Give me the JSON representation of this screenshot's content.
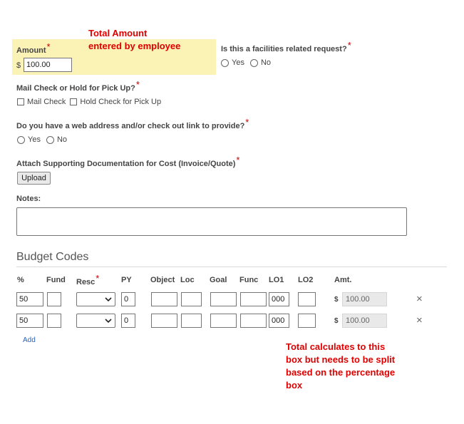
{
  "annotations": {
    "total_amount_line1": "Total Amount",
    "total_amount_line2": "entered by employee",
    "total_calc_line1": "Total calculates to this",
    "total_calc_line2": "box but needs to be split",
    "total_calc_line3": "based on the percentage",
    "total_calc_line4": "box"
  },
  "amount": {
    "label": "Amount",
    "currency": "$",
    "value": "100.00"
  },
  "facilities": {
    "question": "Is this a facilities related request?",
    "yes": "Yes",
    "no": "No"
  },
  "mail_check": {
    "question": "Mail Check or Hold for Pick Up?",
    "option1": "Mail Check",
    "option2": "Hold Check for Pick Up"
  },
  "web_address": {
    "question": "Do you have a web address and/or check out link to provide?",
    "yes": "Yes",
    "no": "No"
  },
  "attach": {
    "question": "Attach Supporting Documentation for Cost (Invoice/Quote)",
    "button": "Upload"
  },
  "notes": {
    "label": "Notes:",
    "value": ""
  },
  "budget": {
    "title": "Budget Codes",
    "headers": {
      "pct": "%",
      "fund": "Fund",
      "resc": "Resc",
      "py": "PY",
      "object": "Object",
      "loc": "Loc",
      "goal": "Goal",
      "func": "Func",
      "lo1": "LO1",
      "lo2": "LO2",
      "amt": "Amt."
    },
    "rows": [
      {
        "pct": "50",
        "py": "0",
        "lo1": "000",
        "currency": "$",
        "amt": "100.00",
        "remove": "×"
      },
      {
        "pct": "50",
        "py": "0",
        "lo1": "000",
        "currency": "$",
        "amt": "100.00",
        "remove": "×"
      }
    ],
    "add_label": "Add"
  },
  "required_marker": "*",
  "colors": {
    "highlight": "#fbf2b6",
    "annotation": "#e00000",
    "required": "#c00000",
    "link": "#2b63b6"
  }
}
